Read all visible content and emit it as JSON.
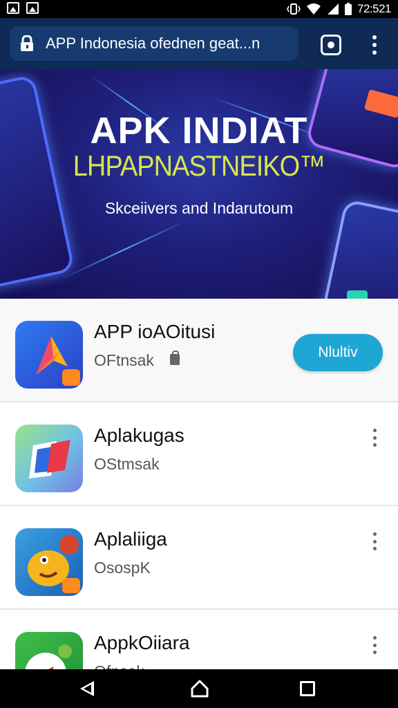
{
  "status_bar": {
    "time": "72:521",
    "icons": [
      "image-icon",
      "image-icon",
      "vibrate-icon",
      "wifi-icon",
      "signal-icon",
      "battery-icon"
    ]
  },
  "browser": {
    "url_text": "APP Indonesia ofednen geat...n",
    "icons": [
      "lock-icon",
      "tab-switcher-icon",
      "overflow-menu-icon"
    ],
    "bar_color": "#0f2a55"
  },
  "banner": {
    "title": "APK INDIAT",
    "subtitle": "LHPAPNASTNEIKO™",
    "tagline": "Skceiivers and Indarutoum",
    "accent_color": "#d9e64a"
  },
  "apps": [
    {
      "name": "APP ioAOitusi",
      "subtitle": "OFtnsak",
      "action_label": "Nlultiv",
      "icon": "arrow-logo-icon"
    },
    {
      "name": "Aplakugas",
      "subtitle": "OStmsak",
      "icon": "cards-logo-icon"
    },
    {
      "name": "Aplaliiga",
      "subtitle": "OsospK",
      "icon": "cartoon-creature-icon"
    },
    {
      "name": "AppkOiiara",
      "subtitle": "Ofnsak",
      "icon": "bird-logo-icon"
    }
  ],
  "accent": {
    "install_button": "#1ea7d4"
  },
  "nav": {
    "icons": [
      "back-icon",
      "home-icon",
      "recents-icon"
    ]
  }
}
